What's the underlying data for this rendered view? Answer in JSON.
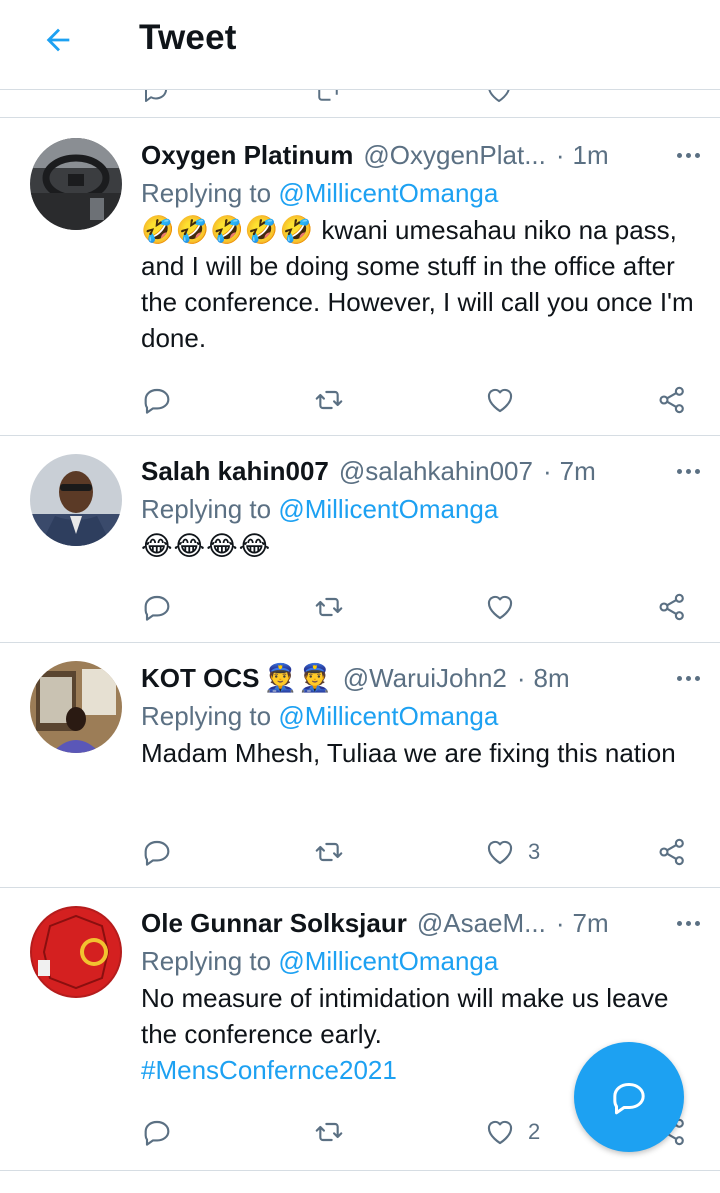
{
  "header": {
    "title": "Tweet"
  },
  "colors": {
    "accent": "#1da1f2",
    "secondary_text": "#5b7083",
    "divider": "#d6dde3"
  },
  "icons": {
    "back": "arrow-left-icon",
    "more": "more-dots-icon",
    "reply": "reply-bubble-icon",
    "retweet": "retweet-icon",
    "like": "heart-icon",
    "share": "share-icon",
    "compose": "compose-reply-icon"
  },
  "tweets": [
    {
      "name": "Oxygen Platinum",
      "handle": "@OxygenPlat...",
      "time": "1m",
      "replying_label": "Replying to",
      "replying_to": "@MillicentOmanga",
      "emoji": "🤣🤣🤣🤣🤣",
      "text": "kwani umesahau niko na pass, and I will be doing some stuff in the office after the conference. However, I will call you once I'm done.",
      "likes": ""
    },
    {
      "name": "Salah kahin007",
      "handle": "@salahkahin007",
      "time": "7m",
      "replying_label": "Replying to",
      "replying_to": "@MillicentOmanga",
      "emoji": "😂😂😂😂",
      "text": "",
      "likes": ""
    },
    {
      "name": "KOT OCS",
      "name_emoji": "👮👮",
      "handle": "@WaruiJohn2",
      "time": "8m",
      "replying_label": "Replying to",
      "replying_to": "@MillicentOmanga",
      "text": "Madam Mhesh, Tuliaa we are fixing this nation",
      "likes": "3"
    },
    {
      "name": "Ole Gunnar Solksjaur",
      "handle": "@AsaeM...",
      "time": "7m",
      "replying_label": "Replying to",
      "replying_to": "@MillicentOmanga",
      "text": "No measure of intimidation will make us leave the conference early.",
      "hashtag": "#MensConfernce2021",
      "likes": "2"
    }
  ]
}
